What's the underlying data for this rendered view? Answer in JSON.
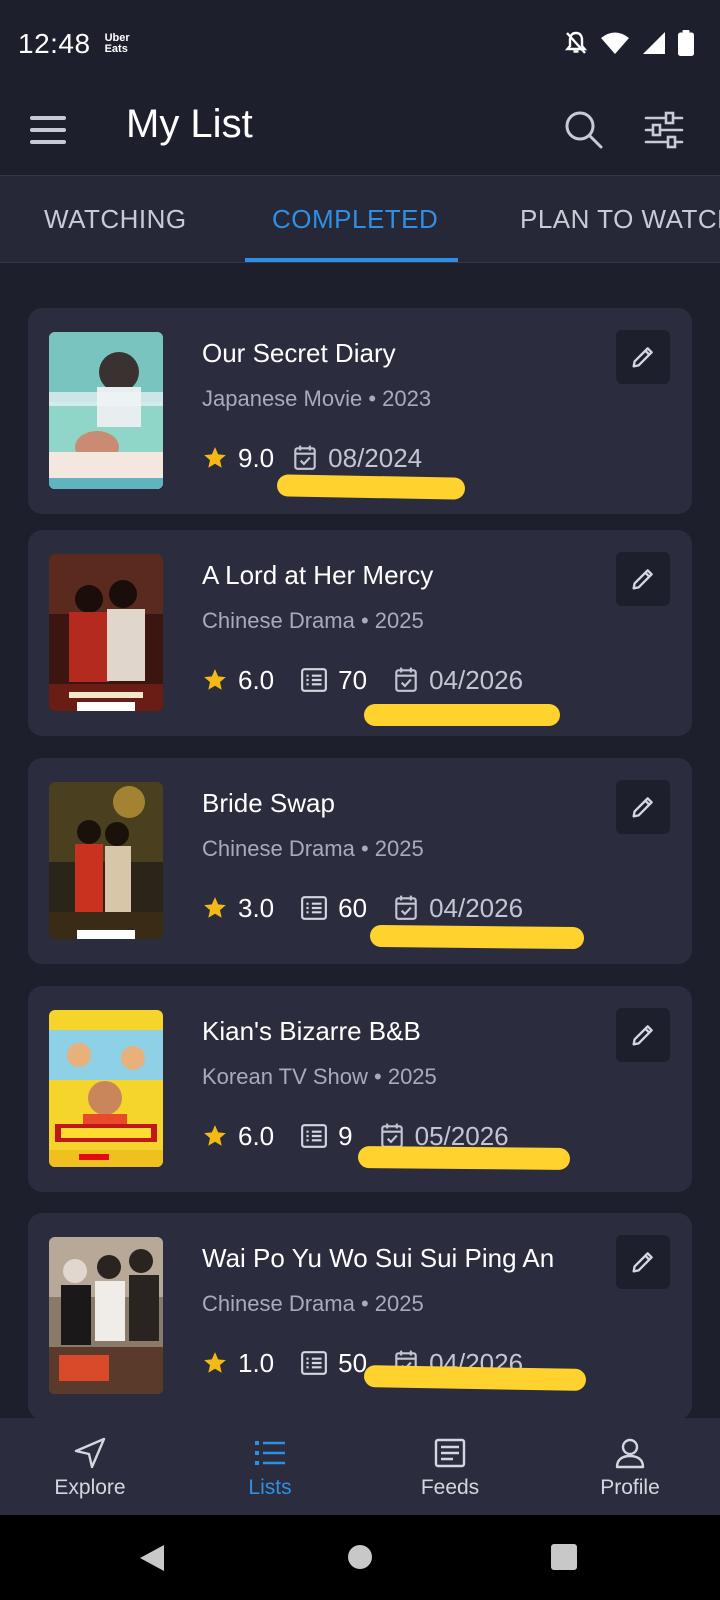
{
  "status": {
    "time": "12:48",
    "app_line1": "Uber",
    "app_line2": "Eats"
  },
  "header": {
    "title": "My List"
  },
  "tabs": [
    {
      "label": "WATCHING"
    },
    {
      "label": "COMPLETED"
    },
    {
      "label": "PLAN TO WATCH"
    }
  ],
  "active_tab": "COMPLETED",
  "items": [
    {
      "title": "Our Secret Diary",
      "type": "Japanese Movie",
      "year": "2023",
      "subtitle": "Japanese Movie • 2023",
      "rating": "9.0",
      "episodes": null,
      "date": "08/2024"
    },
    {
      "title": "A Lord at Her Mercy",
      "type": "Chinese Drama",
      "year": "2025",
      "subtitle": "Chinese Drama • 2025",
      "rating": "6.0",
      "episodes": "70",
      "date": "04/2026"
    },
    {
      "title": "Bride Swap",
      "type": "Chinese Drama",
      "year": "2025",
      "subtitle": "Chinese Drama • 2025",
      "rating": "3.0",
      "episodes": "60",
      "date": "04/2026"
    },
    {
      "title": "Kian's Bizarre B&B",
      "type": "Korean TV Show",
      "year": "2025",
      "subtitle": "Korean TV Show • 2025",
      "rating": "6.0",
      "episodes": "9",
      "date": "05/2026"
    },
    {
      "title": "Wai Po Yu Wo Sui Sui Ping An",
      "type": "Chinese Drama",
      "year": "2025",
      "subtitle": "Chinese Drama • 2025",
      "rating": "1.0",
      "episodes": "50",
      "date": "04/2026"
    }
  ],
  "bottom_nav": [
    {
      "label": "Explore",
      "icon": "navigation-arrow-icon"
    },
    {
      "label": "Lists",
      "icon": "list-icon"
    },
    {
      "label": "Feeds",
      "icon": "news-icon"
    },
    {
      "label": "Profile",
      "icon": "person-icon"
    }
  ],
  "colors": {
    "accent": "#2e8fe6",
    "star": "#f5b915",
    "highlight": "#ffd22e",
    "card": "#2b2c3d",
    "background": "#1e1f2c"
  }
}
